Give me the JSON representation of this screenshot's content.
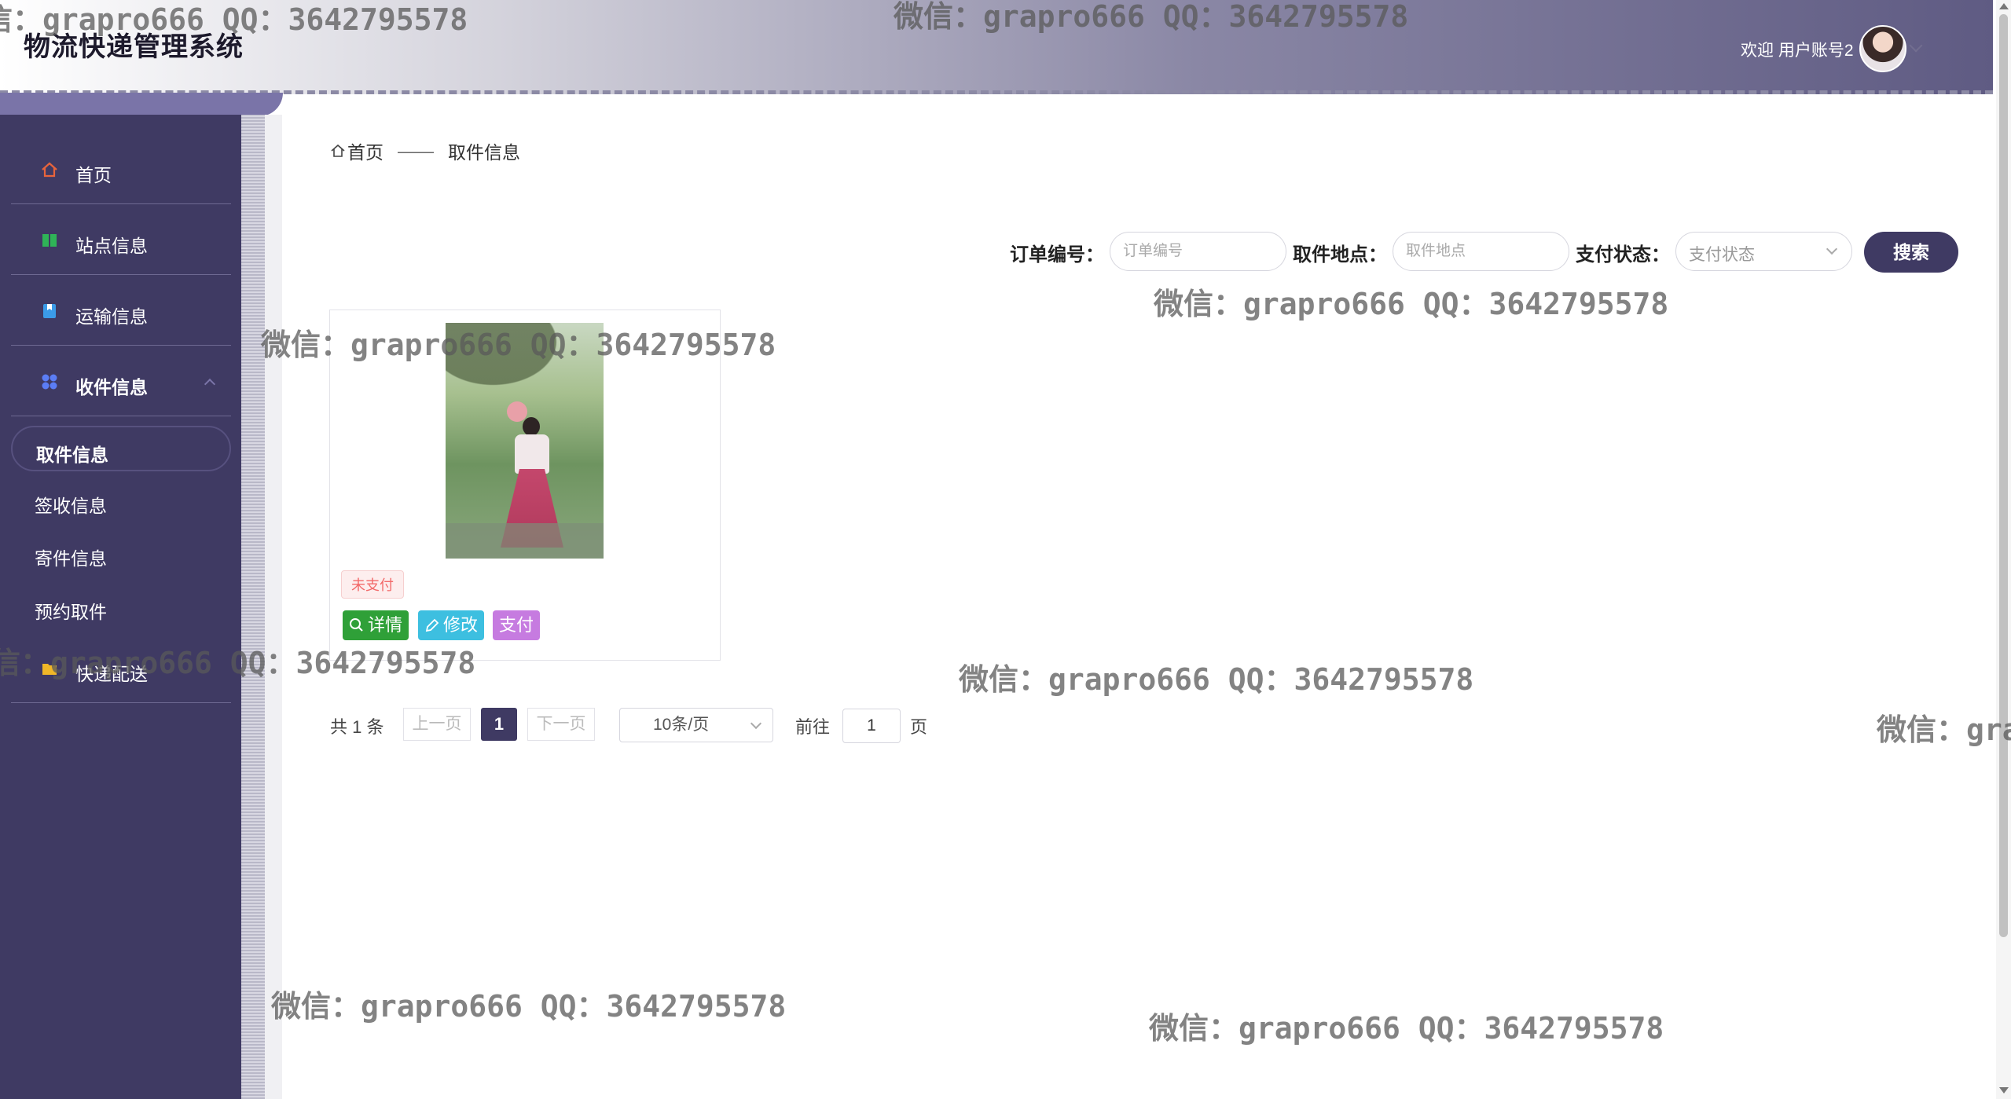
{
  "header": {
    "app_title": "物流快递管理系统",
    "welcome_text": "欢迎 用户账号2"
  },
  "sidebar": {
    "items": [
      {
        "label": "首页",
        "icon": "home-icon",
        "color": "#e8643c"
      },
      {
        "label": "站点信息",
        "icon": "book-icon",
        "color": "#2fb457"
      },
      {
        "label": "运输信息",
        "icon": "bookmark-icon",
        "color": "#3b9be8"
      },
      {
        "label": "收件信息",
        "icon": "grid-icon",
        "color": "#5b7df5",
        "expanded": true
      },
      {
        "label": "快递配送",
        "icon": "folder-icon",
        "color": "#f0b728"
      }
    ],
    "subitems": [
      {
        "label": "取件信息",
        "active": true
      },
      {
        "label": "签收信息"
      },
      {
        "label": "寄件信息"
      },
      {
        "label": "预约取件"
      }
    ]
  },
  "breadcrumb": {
    "home": "首页",
    "separator": "——",
    "current": "取件信息"
  },
  "search": {
    "order_label": "订单编号：",
    "order_placeholder": "订单编号",
    "place_label": "取件地点：",
    "place_placeholder": "取件地点",
    "status_label": "支付状态：",
    "status_placeholder": "支付状态",
    "button": "搜索"
  },
  "card": {
    "status": "未支付",
    "detail_button": "详情",
    "edit_button": "修改",
    "pay_button": "支付"
  },
  "pagination": {
    "total": "共 1 条",
    "prev": "上一页",
    "current": "1",
    "next": "下一页",
    "page_size": "10条/页",
    "goto_prefix": "前往",
    "goto_value": "1",
    "goto_suffix": "页"
  },
  "watermark": "微信：grapro666 QQ：3642795578"
}
